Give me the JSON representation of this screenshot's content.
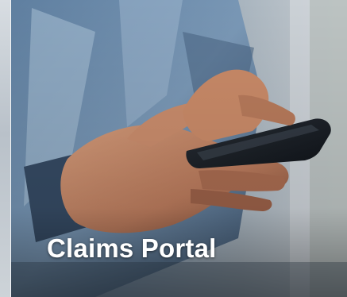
{
  "banner": {
    "title": "Claims Portal",
    "image_subject": "hands-holding-smartphone",
    "title_color": "#ffffff",
    "overlay_color": "#1f2a36"
  }
}
